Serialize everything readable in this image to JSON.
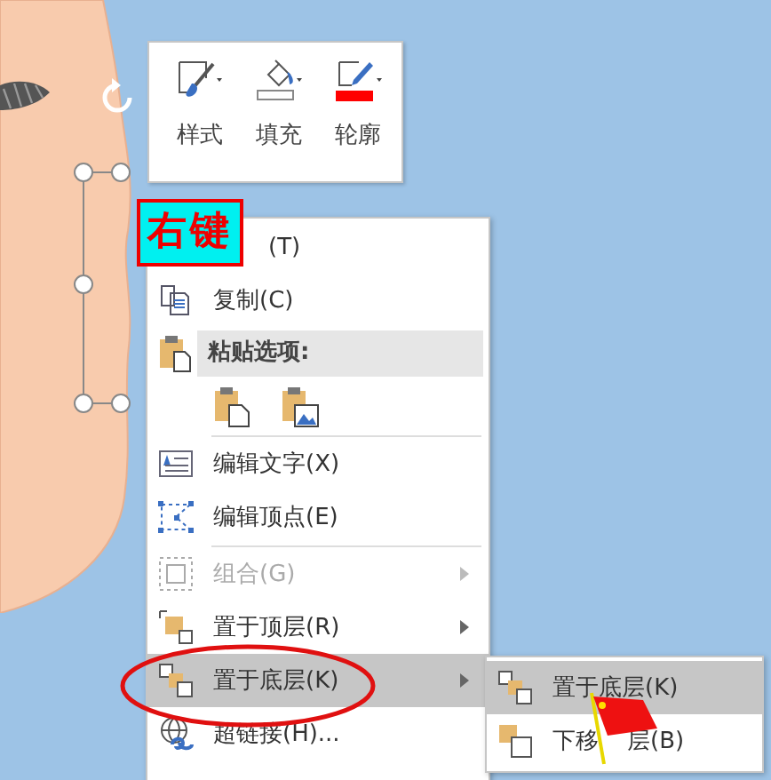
{
  "mini_toolbar": {
    "buttons": [
      {
        "label": "样式"
      },
      {
        "label": "填充"
      },
      {
        "label": "轮廓"
      }
    ]
  },
  "annotation_label": "右键",
  "context_menu": {
    "items": [
      {
        "kind": "item",
        "label": "(T)",
        "disabled": false,
        "selected": false,
        "submenu": false
      },
      {
        "kind": "item",
        "label": "复制(C)",
        "disabled": false,
        "selected": false,
        "submenu": false
      },
      {
        "kind": "header",
        "label": "粘贴选项:"
      },
      {
        "kind": "paste-options"
      },
      {
        "kind": "separator"
      },
      {
        "kind": "item",
        "label": "编辑文字(X)",
        "disabled": false,
        "selected": false,
        "submenu": false
      },
      {
        "kind": "item",
        "label": "编辑顶点(E)",
        "disabled": false,
        "selected": false,
        "submenu": false
      },
      {
        "kind": "separator"
      },
      {
        "kind": "item",
        "label": "组合(G)",
        "disabled": true,
        "selected": false,
        "submenu": true
      },
      {
        "kind": "item",
        "label": "置于顶层(R)",
        "disabled": false,
        "selected": false,
        "submenu": true
      },
      {
        "kind": "item",
        "label": "置于底层(K)",
        "disabled": false,
        "selected": true,
        "submenu": true
      },
      {
        "kind": "item",
        "label": "超链接(H)...",
        "disabled": false,
        "selected": false,
        "submenu": false
      }
    ]
  },
  "submenu": {
    "items": [
      {
        "label_parts": [
          "置于底层(K)"
        ],
        "selected": true
      },
      {
        "label_parts": [
          "下移",
          "层(B)"
        ],
        "selected": false
      }
    ]
  }
}
